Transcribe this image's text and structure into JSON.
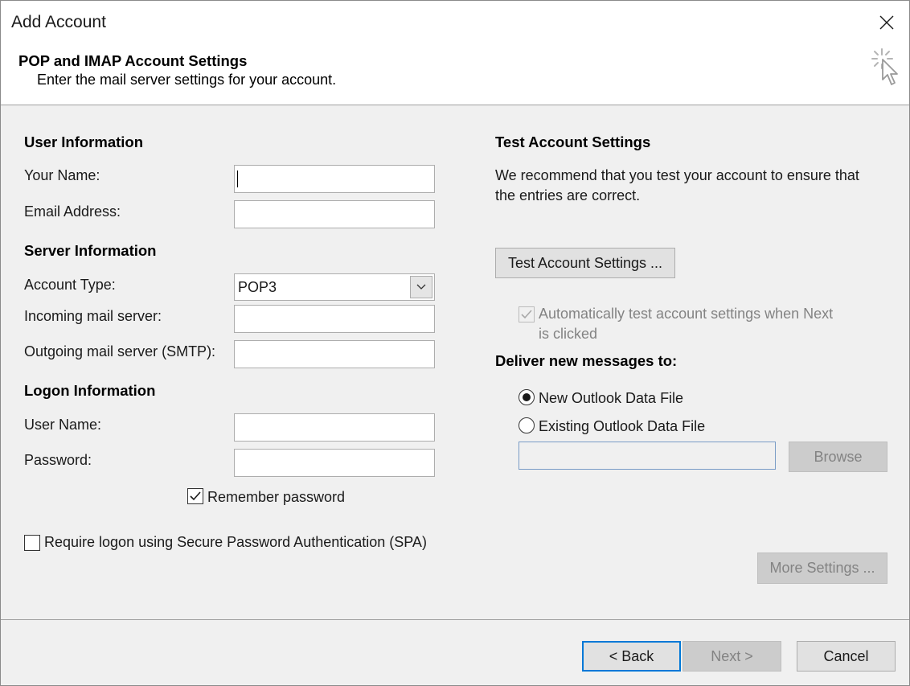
{
  "window": {
    "title": "Add Account"
  },
  "header": {
    "title": "POP and IMAP Account Settings",
    "subtitle": "Enter the mail server settings for your account."
  },
  "user_info": {
    "heading": "User Information",
    "your_name_label": "Your Name:",
    "your_name_value": "",
    "email_label": "Email Address:",
    "email_value": ""
  },
  "server_info": {
    "heading": "Server Information",
    "account_type_label": "Account Type:",
    "account_type_value": "POP3",
    "incoming_label": "Incoming mail server:",
    "incoming_value": "",
    "outgoing_label": "Outgoing mail server (SMTP):",
    "outgoing_value": ""
  },
  "logon_info": {
    "heading": "Logon Information",
    "username_label": "User Name:",
    "username_value": "",
    "password_label": "Password:",
    "password_value": "",
    "remember_label": "Remember password",
    "remember_checked": true,
    "spa_label": "Require logon using Secure Password Authentication (SPA)",
    "spa_checked": false
  },
  "test_settings": {
    "heading": "Test Account Settings",
    "description_line1": "We recommend that you test your account to ensure that",
    "description_line2": "the entries are correct.",
    "test_button": "Test Account Settings ...",
    "auto_test_line1": "Automatically test account settings when Next",
    "auto_test_line2": "is clicked",
    "auto_test_checked": true
  },
  "deliver": {
    "heading": "Deliver new messages to:",
    "option_new": "New Outlook Data File",
    "option_existing": "Existing Outlook Data File",
    "selected": "new",
    "browse_button": "Browse"
  },
  "more_settings_button": "More Settings ...",
  "footer": {
    "back": "< Back",
    "next": "Next >",
    "cancel": "Cancel"
  },
  "icons": [
    "close-icon",
    "wizard-cursor-icon",
    "chevron-down-icon",
    "checkmark-icon",
    "radio-selected-icon"
  ]
}
